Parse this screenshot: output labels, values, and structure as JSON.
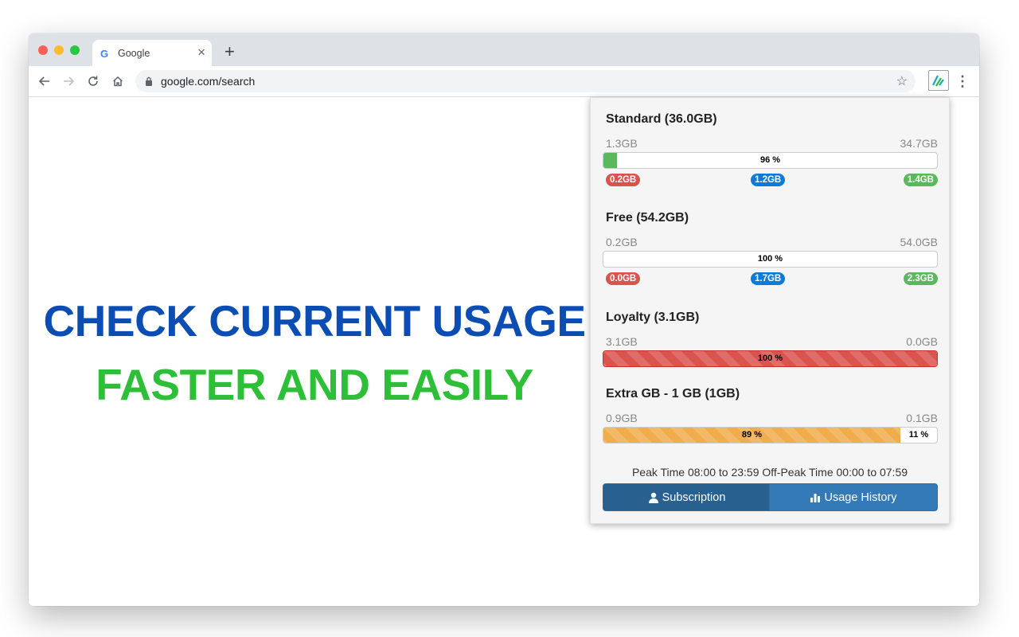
{
  "browser": {
    "tab_title": "Google",
    "tab_close": "×",
    "new_tab": "+",
    "url": "google.com/search"
  },
  "hero": {
    "line1": "CHECK CURRENT USAGE",
    "line2": "FASTER AND EASILY",
    "line1_color": "#0b4db3",
    "line2_color": "#2ebf38"
  },
  "popup": {
    "sections": [
      {
        "title": "Standard (36.0GB)",
        "left_value": "1.3GB",
        "right_value": "34.7GB",
        "bar_label": "96 %",
        "fill_fraction": 0.04,
        "fill_color": "#5cb85c",
        "badges": [
          "0.2GB",
          "1.2GB",
          "1.4GB"
        ]
      },
      {
        "title": "Free (54.2GB)",
        "left_value": "0.2GB",
        "right_value": "54.0GB",
        "bar_label": "100 %",
        "fill_fraction": 0.0,
        "badges": [
          "0.0GB",
          "1.7GB",
          "2.3GB"
        ]
      },
      {
        "title": "Loyalty (3.1GB)",
        "left_value": "3.1GB",
        "right_value": "0.0GB",
        "bar_label": "100 %",
        "fill_fraction": 1.0,
        "fill_color": "#d9534f"
      },
      {
        "title": "Extra GB - 1 GB (1GB)",
        "left_value": "0.9GB",
        "right_value": "0.1GB",
        "bar_label_used": "89 %",
        "bar_label_remaining": "11 %",
        "fill_fraction": 0.89,
        "fill_color": "#f0ad4e"
      }
    ],
    "badge_colors": {
      "red": "#d9534f",
      "blue": "#0a7bd6",
      "green": "#5cb85c"
    },
    "peak_text": "Peak Time 08:00 to 23:59 Off-Peak Time 00:00 to 07:59",
    "buttons": {
      "subscription": "Subscription",
      "usage_history": "Usage History"
    }
  }
}
